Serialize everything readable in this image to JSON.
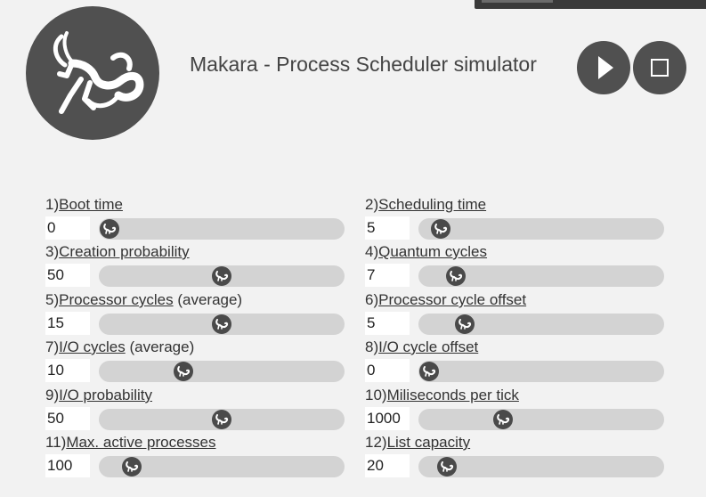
{
  "app": {
    "title": "Makara - Process Scheduler simulator",
    "logo_icon": "capricorn-sea-goat-icon",
    "accent_dark": "#505050",
    "track_color": "#d3d3d3"
  },
  "controls": {
    "play_icon": "play-icon",
    "stop_icon": "stop-icon"
  },
  "params": [
    {
      "number": "1)",
      "name": "Boot time",
      "suffix": "",
      "value": "0",
      "slider_fraction": 0.0
    },
    {
      "number": "2)",
      "name": "Scheduling time",
      "suffix": "",
      "value": "5",
      "slider_fraction": 0.05
    },
    {
      "number": "3)",
      "name": "Creation probability",
      "suffix": "",
      "value": "50",
      "slider_fraction": 0.5
    },
    {
      "number": "4)",
      "name": "Quantum cycles",
      "suffix": "",
      "value": "7",
      "slider_fraction": 0.12
    },
    {
      "number": "5)",
      "name": "Processor cycles",
      "suffix": " (average)",
      "value": "15",
      "slider_fraction": 0.5
    },
    {
      "number": "6)",
      "name": "Processor cycle offset",
      "suffix": "",
      "value": "5",
      "slider_fraction": 0.16
    },
    {
      "number": "7)",
      "name": "I/O cycles",
      "suffix": " (average)",
      "value": "10",
      "slider_fraction": 0.33
    },
    {
      "number": "8)",
      "name": "I/O cycle offset",
      "suffix": "",
      "value": "0",
      "slider_fraction": 0.0
    },
    {
      "number": "9)",
      "name": "I/O probability",
      "suffix": "",
      "value": "50",
      "slider_fraction": 0.5
    },
    {
      "number": "10)",
      "name": "Miliseconds per tick",
      "suffix": "",
      "value": "1000",
      "slider_fraction": 0.33
    },
    {
      "number": "11)",
      "name": "Max. active processes",
      "suffix": "",
      "value": "100",
      "slider_fraction": 0.1
    },
    {
      "number": "12)",
      "name": "List capacity",
      "suffix": "",
      "value": "20",
      "slider_fraction": 0.08
    }
  ]
}
